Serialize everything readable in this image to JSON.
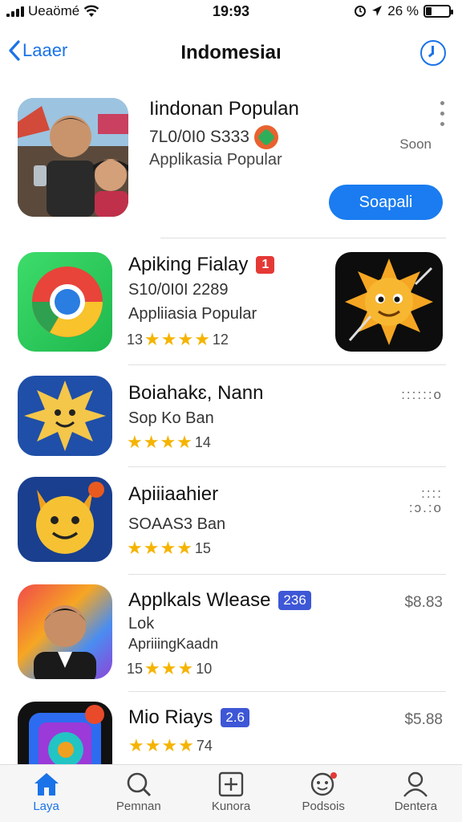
{
  "status_bar": {
    "carrier": "Ueaömé",
    "time": "19:93",
    "battery": "26 %",
    "battery_level": 0.26
  },
  "nav": {
    "back_label": "Laaer",
    "title": "Indomesiaı"
  },
  "featured": {
    "title": "Iindonan Populan",
    "subtitle": "7L0/0I0 S333",
    "category": "Applikasia Popular",
    "size": "Soon",
    "button_label": "Soapali"
  },
  "apps": [
    {
      "title": "Apiking Fialay",
      "badge": "1",
      "line1": "S10/0I0I 2289",
      "line2": "Appliiasia Popular",
      "rating_prefix": "13",
      "stars": 4,
      "rating_count": "12",
      "meta": ""
    },
    {
      "title": "Boiahakɛ, Nann",
      "badge": "",
      "line1": "Sop Ko Ban",
      "line2": "",
      "rating_prefix": "",
      "stars": 4,
      "rating_count": "14",
      "meta": "::::::o"
    },
    {
      "title": "Apiiiaahier",
      "badge": "",
      "line1": "SOAAS3 Ban",
      "line2": "",
      "rating_prefix": "",
      "stars": 4,
      "rating_count": "15",
      "meta": "::::\n:ɔ.:o"
    },
    {
      "title": "Applkals Wlease",
      "badge": "236",
      "line1": "Lok",
      "line2": "ApriiingKaadn",
      "rating_prefix": "15",
      "stars": 3,
      "rating_count": "10",
      "meta": "$8.83"
    },
    {
      "title": "Mio Riays",
      "badge": "2.6",
      "line1": "",
      "line2": "",
      "rating_prefix": "",
      "stars": 4,
      "rating_count": "74",
      "meta": "$5.88"
    }
  ],
  "tabs": [
    {
      "label": "Laya",
      "icon": "home-icon",
      "active": true
    },
    {
      "label": "Pemnan",
      "icon": "search-icon",
      "active": false
    },
    {
      "label": "Kunora",
      "icon": "plus-square-icon",
      "active": false
    },
    {
      "label": "Podsois",
      "icon": "chat-face-icon",
      "active": false
    },
    {
      "label": "Dentera",
      "icon": "person-icon",
      "active": false
    }
  ],
  "colors": {
    "accent": "#1a73e8",
    "button": "#1a7cf0",
    "star": "#f5b400",
    "badge_red": "#e53935",
    "badge_blue": "#3e57d6"
  }
}
